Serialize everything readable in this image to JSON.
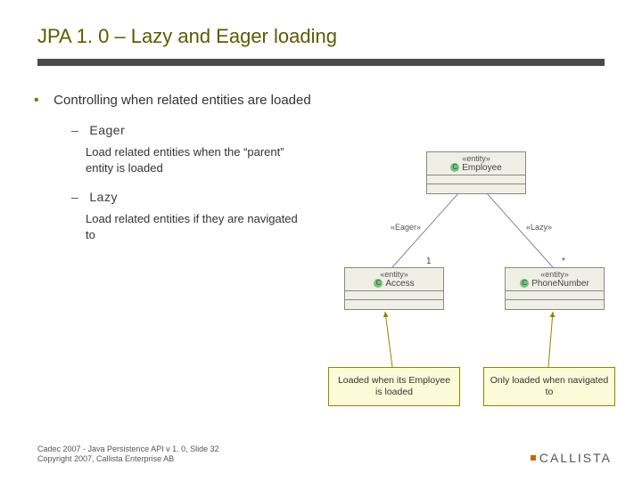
{
  "title": "JPA 1. 0 – Lazy and Eager loading",
  "bullet_main": "Controlling when related entities are loaded",
  "eager": {
    "heading": "Eager",
    "body": "Load related entities when the “parent” entity is loaded"
  },
  "lazy": {
    "heading": "Lazy",
    "body": "Load related entities if they are navigated to"
  },
  "diagram": {
    "stereotype": "«entity»",
    "employee": "Employee",
    "access": "Access",
    "phone": "PhoneNumber",
    "eager_label": "«Eager»",
    "lazy_label": "«Lazy»",
    "mult_one": "1",
    "mult_many": "*"
  },
  "callouts": {
    "left": "Loaded when its Employee is loaded",
    "right": "Only loaded when navigated to"
  },
  "footer": {
    "line1": "Cadec 2007 - Java Persistence API v 1. 0, Slide 32",
    "line2": "Copyright 2007, Callista Enterprise AB"
  },
  "logo": "CALLISTA"
}
